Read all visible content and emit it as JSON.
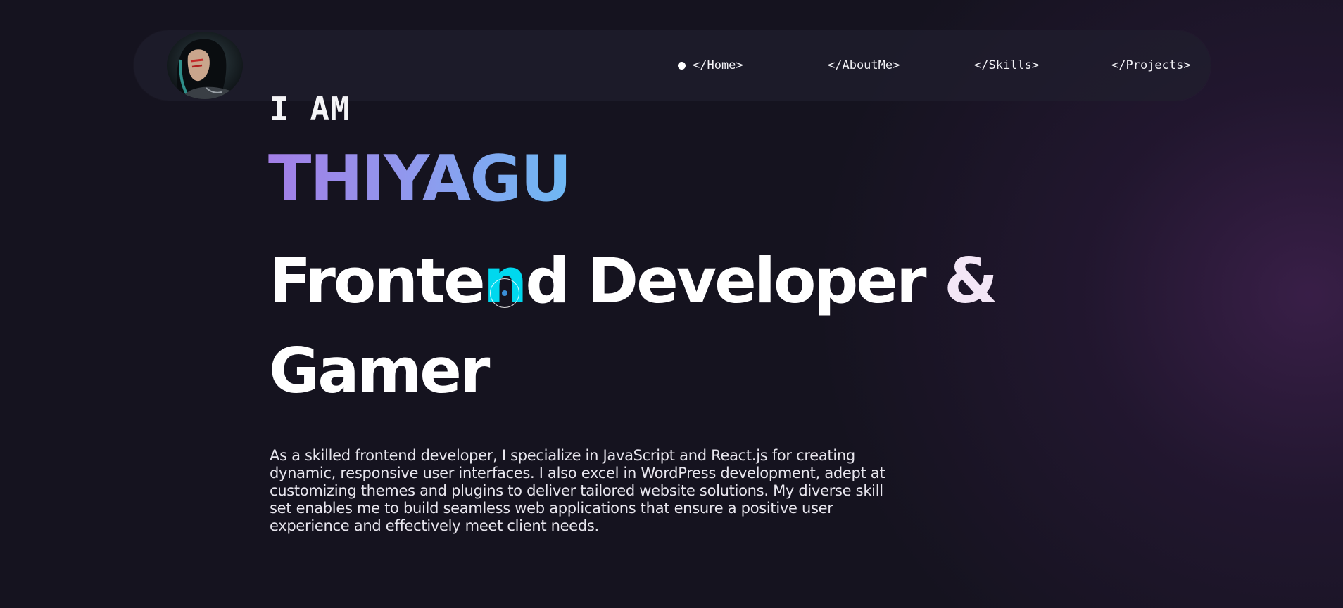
{
  "nav": {
    "avatar_alt": "profile avatar",
    "links": [
      {
        "label": "</Home>",
        "active": true
      },
      {
        "label": "</AboutMe>",
        "active": false
      },
      {
        "label": "</Skills>",
        "active": false
      },
      {
        "label": "</Projects>",
        "active": false
      }
    ]
  },
  "hero": {
    "intro": "I AM",
    "name": "THIYAGU",
    "role_part1": "Fronte",
    "role_highlight": "n",
    "role_part2": "d Developer ",
    "role_amp": "&",
    "role_line2": "Gamer",
    "description": "As a skilled frontend developer, I specialize in JavaScript and React.js for creating dynamic, responsive user interfaces. I also excel in WordPress development, adept at customizing themes and plugins to deliver tailored website solutions. My diverse skill set enables me to build seamless web applications that ensure a positive user experience and effectively meet client needs."
  },
  "colors": {
    "background": "#15131f",
    "name_gradient_start": "#a27ee6",
    "name_gradient_end": "#6eb9f4",
    "highlight": "#00d8ee",
    "ampersand": "#f3e6f6"
  },
  "icons": {
    "active_indicator": "dot-icon",
    "cursor": "cursor-ring-icon"
  }
}
